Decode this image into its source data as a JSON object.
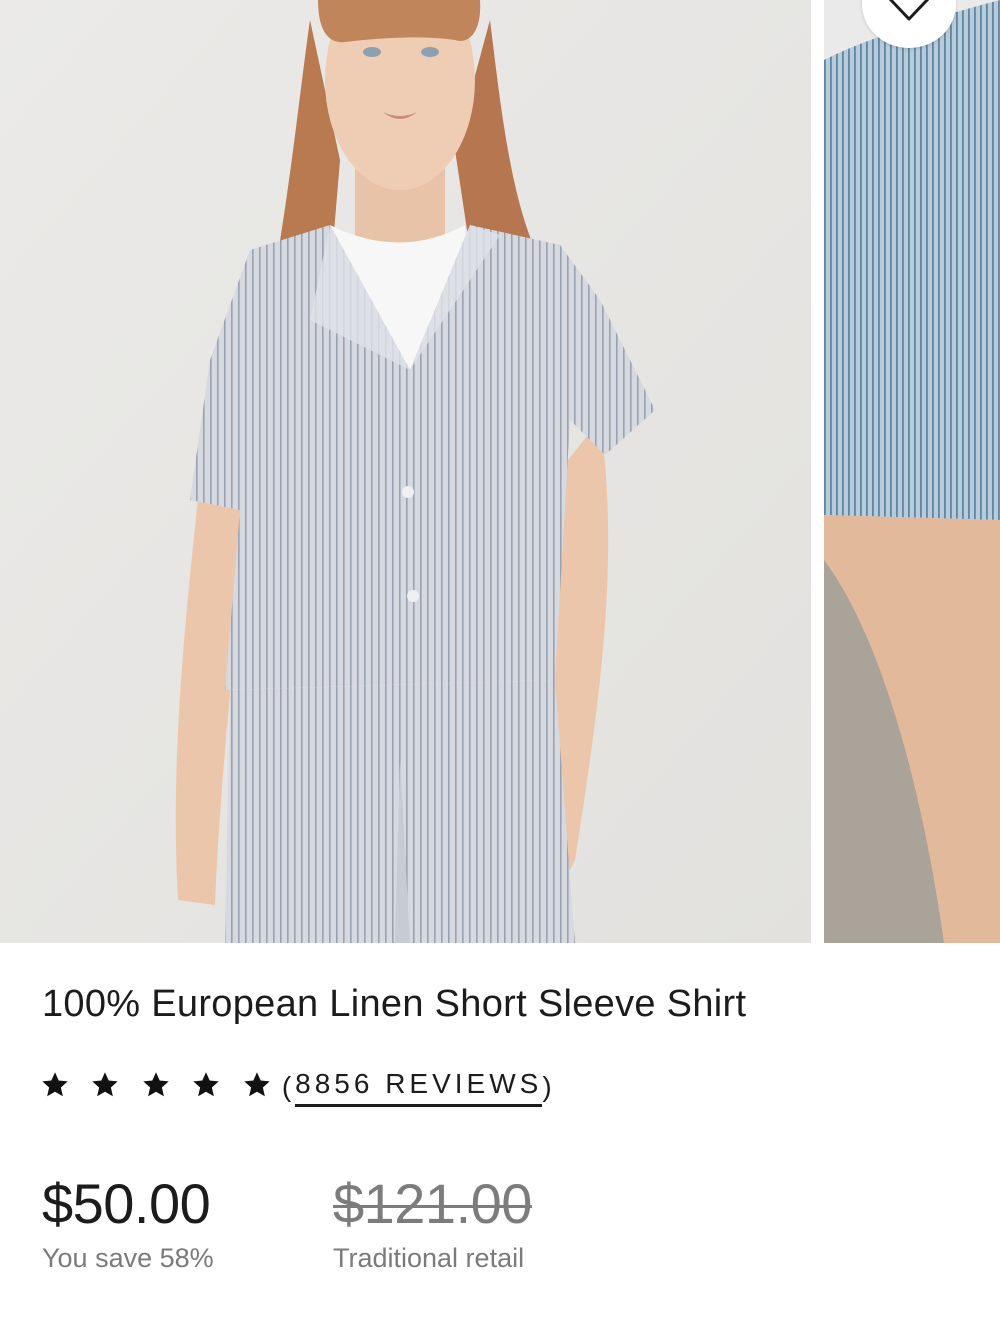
{
  "product": {
    "title": "100% European Linen Short Sleeve Shirt",
    "rating_stars": 5,
    "reviews_open": "(",
    "reviews_link": "8856 REVIEWS",
    "reviews_close": ")",
    "price": "$50.00",
    "savings_text": "You save 58%",
    "original_price": "$121.00",
    "original_price_label": "Traditional retail"
  },
  "gallery": {
    "main_image_icon": "model-in-striped-linen-shirt-photo",
    "next_image_icon": "striped-sleeve-closeup-photo",
    "favorite_icon": "heart-outline-icon"
  },
  "colors": {
    "text": "#1c1c1c",
    "muted": "#7b7b7b",
    "strike": "#7c7c7c",
    "star": "#111111"
  }
}
